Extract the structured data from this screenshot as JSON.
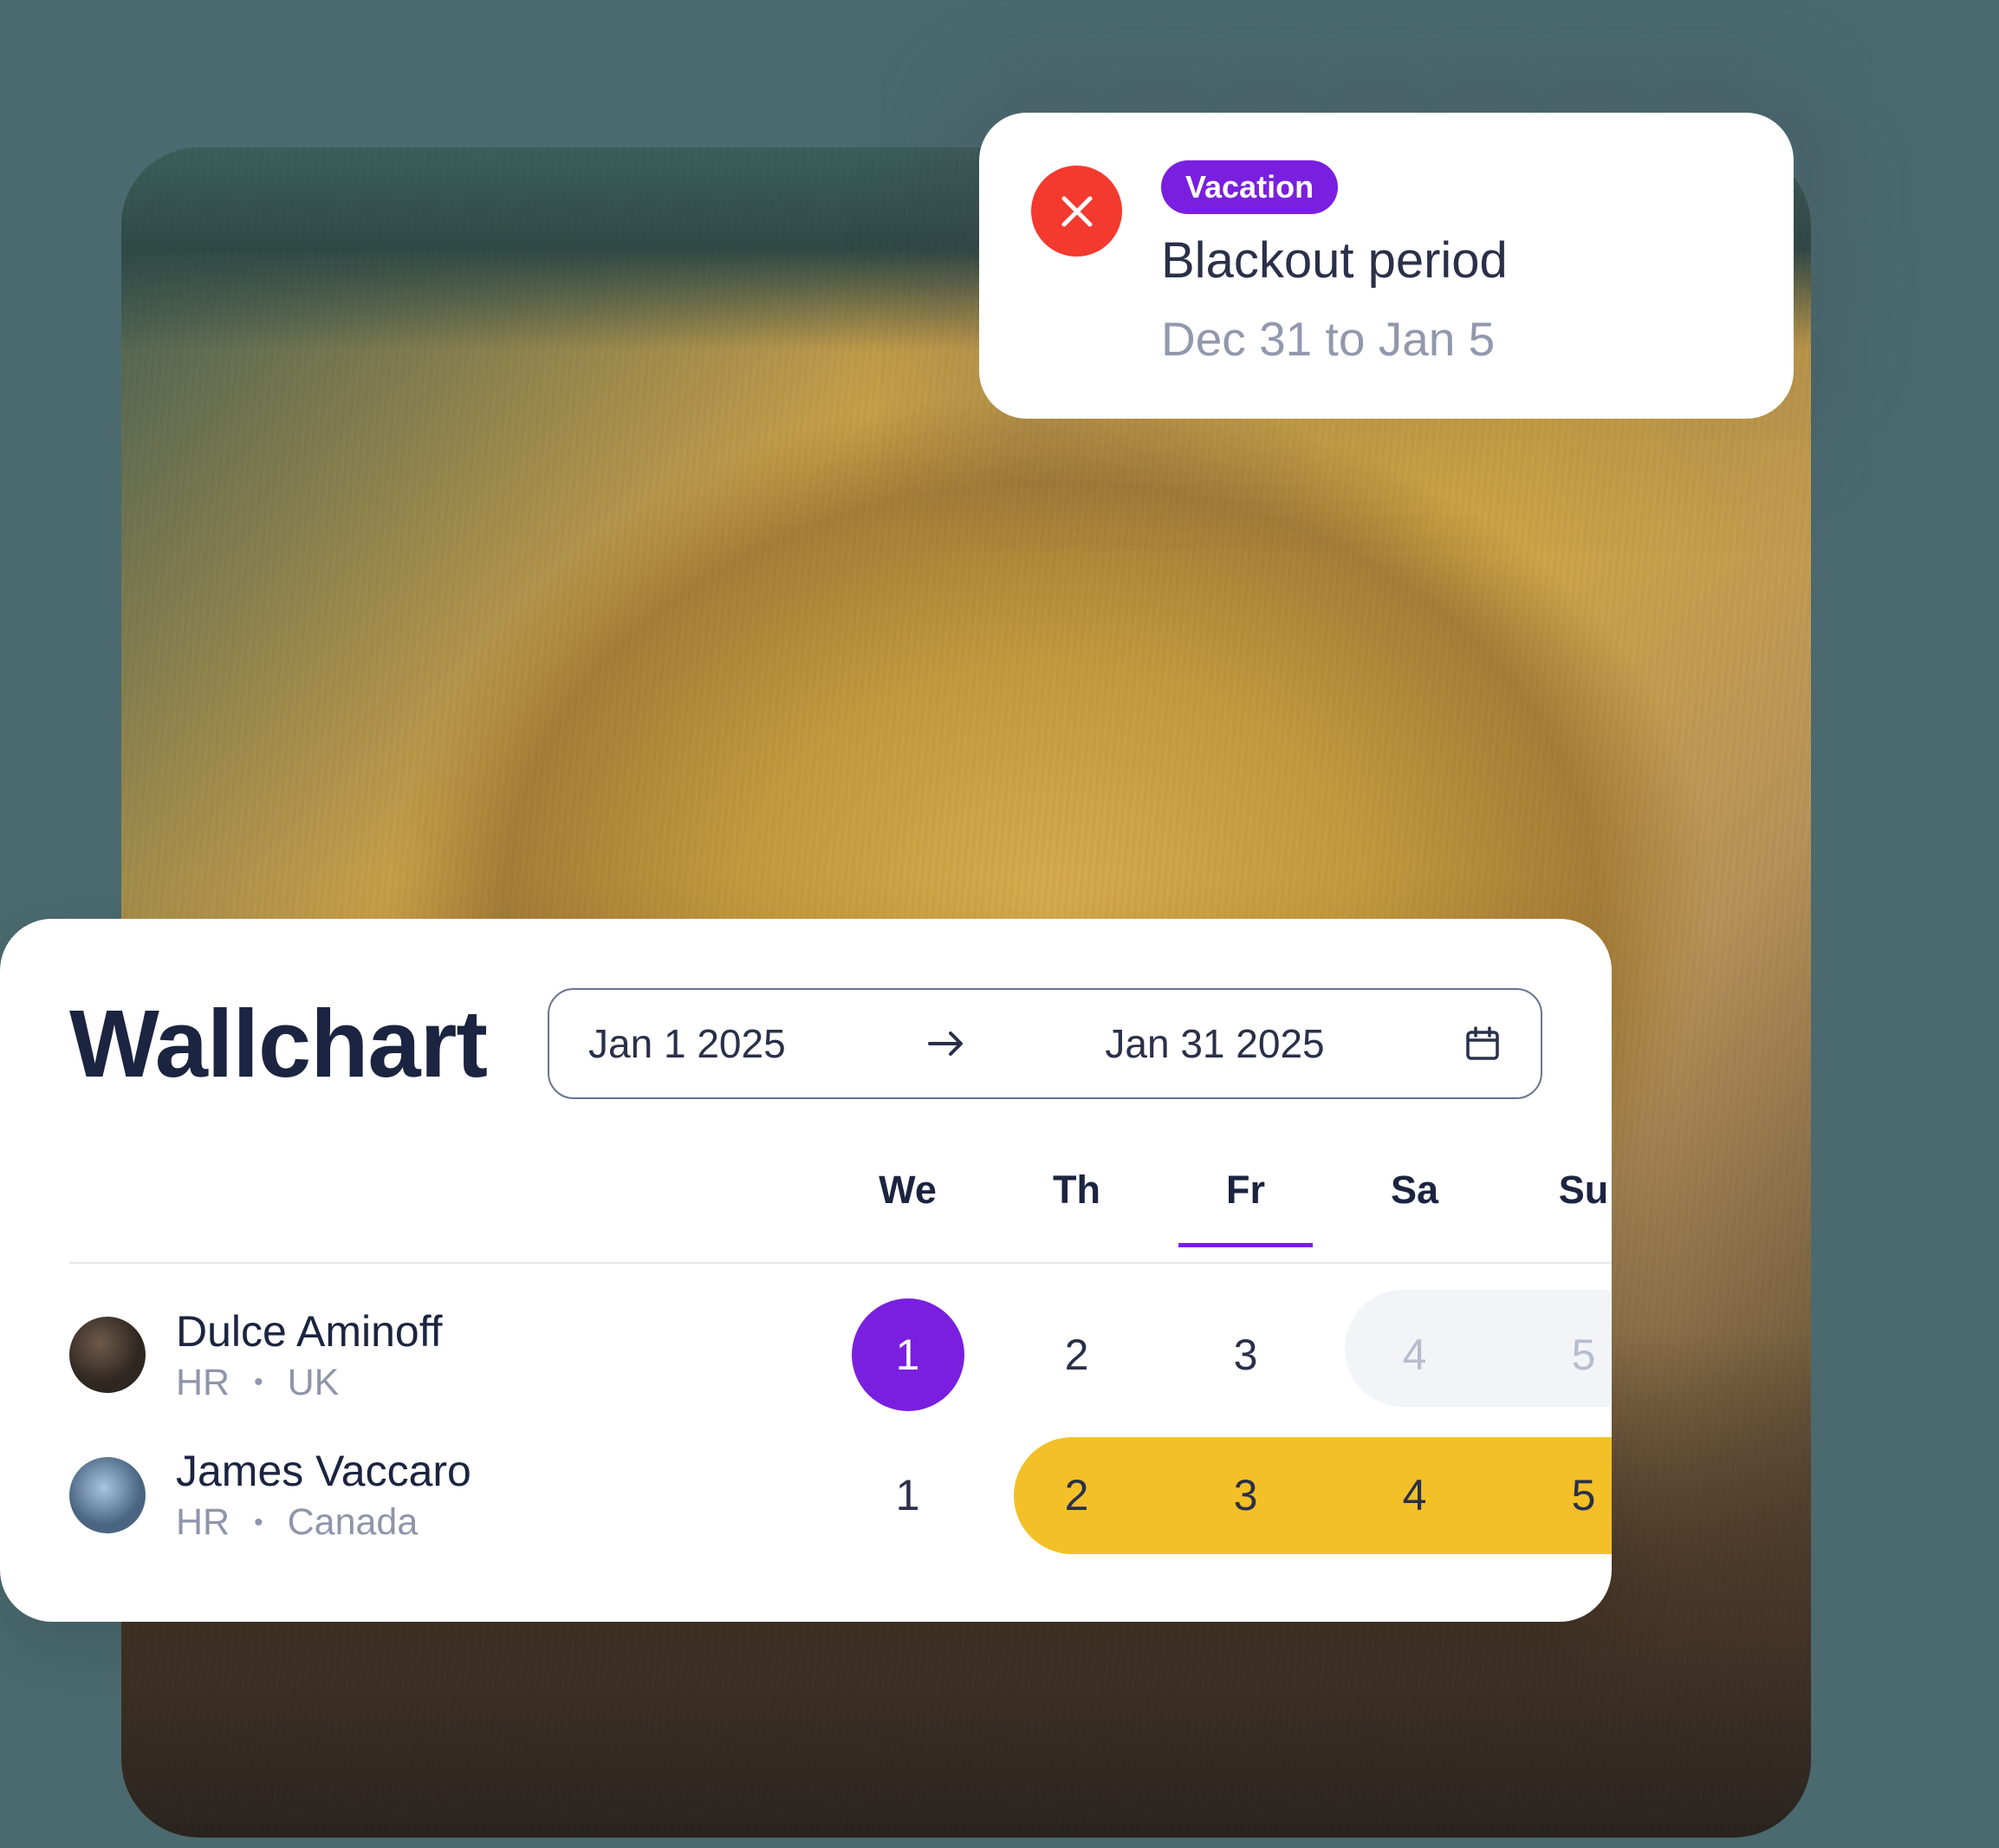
{
  "notification": {
    "badge": "Vacation",
    "title": "Blackout period",
    "date_range": "Dec 31 to Jan 5"
  },
  "wallchart": {
    "title": "Wallchart",
    "date_picker": {
      "start": "Jan 1 2025",
      "end": "Jan 31 2025"
    },
    "day_headers": [
      "We",
      "Th",
      "Fr",
      "Sa",
      "Su"
    ],
    "active_day_index": 2,
    "rows": [
      {
        "name": "Dulce Aminoff",
        "dept": "HR",
        "location": "UK",
        "days": [
          "1",
          "2",
          "3",
          "4",
          "5"
        ]
      },
      {
        "name": "James Vaccaro",
        "dept": "HR",
        "location": "Canada",
        "days": [
          "1",
          "2",
          "3",
          "4",
          "5"
        ]
      }
    ]
  },
  "colors": {
    "purple": "#7a1fe0",
    "red": "#f4392f",
    "yellow": "#f3c027"
  }
}
